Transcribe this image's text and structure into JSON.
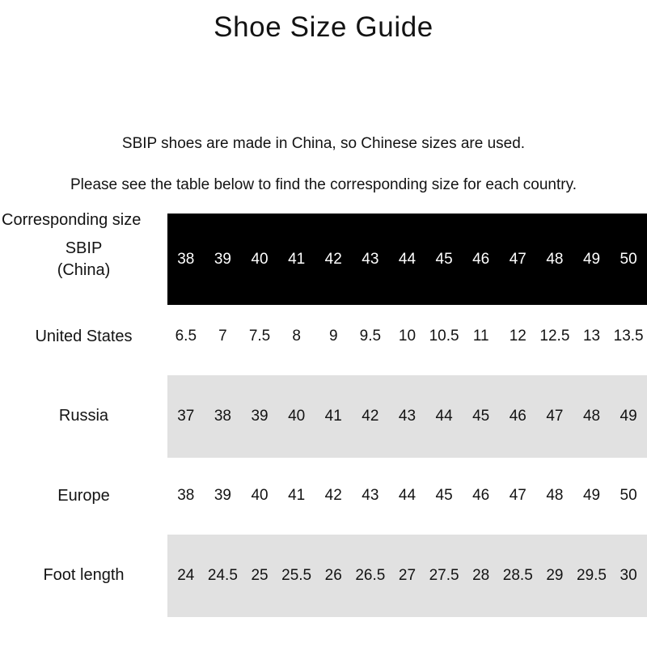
{
  "page": {
    "title": "Shoe Size Guide",
    "intro_line_1": "SBIP shoes are made in China, so Chinese sizes are used.",
    "intro_line_2": "Please see the table below to find the corresponding size for each country.",
    "corresponding_size_caption": "Corresponding size"
  },
  "colors": {
    "header_band_background": "#000000",
    "header_band_text": "#ffffff",
    "shaded_row_background": "#e1e1e1",
    "text": "#131313",
    "page_background": "#ffffff"
  },
  "table": {
    "column_count": 13,
    "rows": [
      {
        "label": "SBIP\n(China)",
        "label_lines": [
          "SBIP",
          "(China)"
        ],
        "style": "inverted",
        "values": [
          "38",
          "39",
          "40",
          "41",
          "42",
          "43",
          "44",
          "45",
          "46",
          "47",
          "48",
          "49",
          "50"
        ]
      },
      {
        "label": "United States",
        "label_lines": [
          "United States"
        ],
        "style": "plain",
        "values": [
          "6.5",
          "7",
          "7.5",
          "8",
          "9",
          "9.5",
          "10",
          "10.5",
          "11",
          "12",
          "12.5",
          "13",
          "13.5"
        ]
      },
      {
        "label": "Russia",
        "label_lines": [
          "Russia"
        ],
        "style": "shaded",
        "values": [
          "37",
          "38",
          "39",
          "40",
          "41",
          "42",
          "43",
          "44",
          "45",
          "46",
          "47",
          "48",
          "49"
        ]
      },
      {
        "label": "Europe",
        "label_lines": [
          "Europe"
        ],
        "style": "plain",
        "values": [
          "38",
          "39",
          "40",
          "41",
          "42",
          "43",
          "44",
          "45",
          "46",
          "47",
          "48",
          "49",
          "50"
        ]
      },
      {
        "label": "Foot length",
        "label_lines": [
          "Foot length"
        ],
        "style": "shaded",
        "values": [
          "24",
          "24.5",
          "25",
          "25.5",
          "26",
          "26.5",
          "27",
          "27.5",
          "28",
          "28.5",
          "29",
          "29.5",
          "30"
        ]
      }
    ]
  }
}
